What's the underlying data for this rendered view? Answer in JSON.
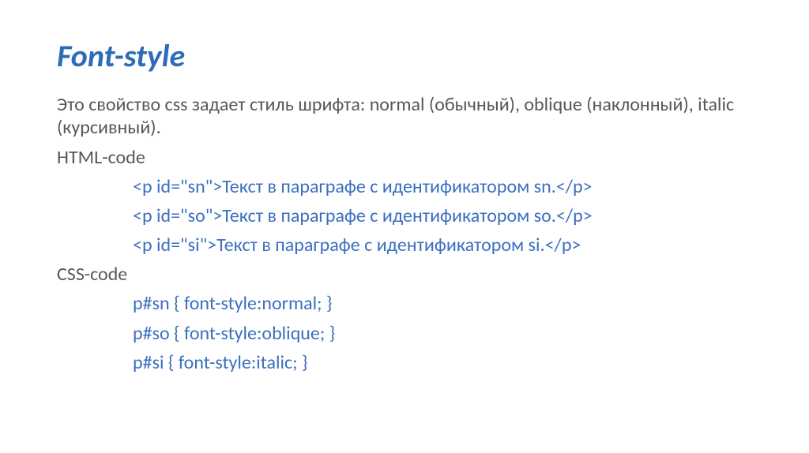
{
  "title": "Font-style",
  "description": "Это свойство css задает стиль шрифта: normal (обычный), oblique (наклонный), italic (курсивный).",
  "html_label": "HTML-code",
  "html_lines": [
    "<p id=\"sn\">Текст в параграфе с идентификатором sn.</p>",
    "<p id=\"so\">Текст в параграфе с идентификатором so.</p>",
    "<p id=\"si\">Текст в параграфе с идентификатором si.</p>"
  ],
  "css_label": "CSS-code",
  "css_lines": [
    "p#sn { font-style:normal; }",
    "p#so { font-style:oblique; }",
    "p#si { font-style:italic; }"
  ]
}
